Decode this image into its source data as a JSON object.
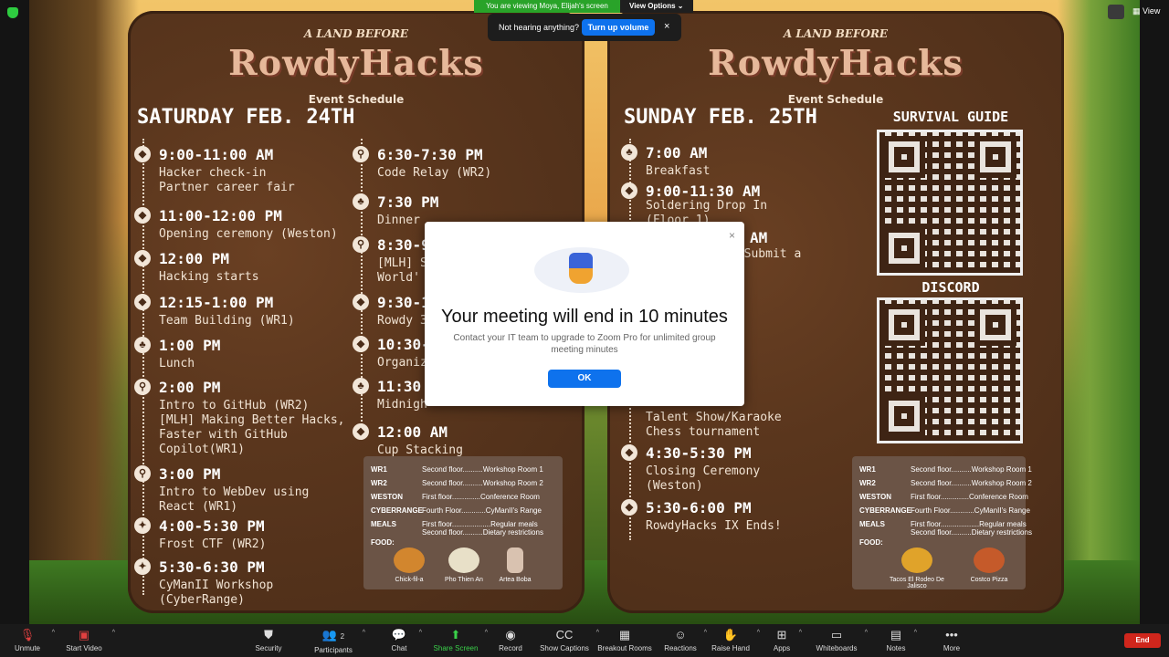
{
  "banner": {
    "viewing": "You are viewing Moya, Elijah's screen",
    "view_options": "View Options",
    "hearing_text": "Not hearing anything?",
    "turn_up": "Turn up volume",
    "close": "×",
    "view": "View"
  },
  "poster_left": {
    "logo_top": "A LAND BEFORE",
    "logo_main": "RowdyHacks",
    "logo_sub": "Event Schedule",
    "day": "SATURDAY FEB. 24TH",
    "col1": [
      {
        "time": "9:00-11:00 AM",
        "desc": "Hacker check-in\nPartner career fair"
      },
      {
        "time": "11:00-12:00 PM",
        "desc": "Opening ceremony (Weston)"
      },
      {
        "time": "12:00 PM",
        "desc": "Hacking starts"
      },
      {
        "time": "12:15-1:00 PM",
        "desc": "Team Building (WR1)"
      },
      {
        "time": "1:00 PM",
        "desc": "Lunch"
      },
      {
        "time": "2:00 PM",
        "desc": "Intro to GitHub (WR2)\n[MLH] Making Better Hacks,\nFaster with GitHub\nCopilot(WR1)"
      },
      {
        "time": "3:00 PM",
        "desc": "Intro to WebDev using\nReact (WR1)"
      },
      {
        "time": "4:00-5:30 PM",
        "desc": "Frost CTF (WR2)"
      },
      {
        "time": "5:30-6:30 PM",
        "desc": "CyManII Workshop\n(CyberRange)"
      }
    ],
    "col2": [
      {
        "time": "6:30-7:30 PM",
        "desc": "Code Relay (WR2)"
      },
      {
        "time": "7:30 PM",
        "desc": "Dinner"
      },
      {
        "time": "8:30-9",
        "desc": "[MLH] S\nWorld' ("
      },
      {
        "time": "9:30-1",
        "desc": "Rowdy 3"
      },
      {
        "time": "10:30-",
        "desc": "Organiz"
      },
      {
        "time": "11:30 P",
        "desc": "Midnigh"
      },
      {
        "time": "12:00 AM",
        "desc": "Cup Stacking"
      }
    ]
  },
  "poster_right": {
    "logo_top": "A LAND BEFORE",
    "logo_main": "RowdyHacks",
    "logo_sub": "Event Schedule",
    "day": "SUNDAY FEB. 25TH",
    "events": [
      {
        "time": "7:00 AM",
        "desc": "Breakfast"
      },
      {
        "time": "9:00-11:30 AM",
        "desc": "Soldering Drop In\n(Floor 1)"
      },
      {
        "time": "AM",
        "desc": "d Submit a"
      },
      {
        "time": "",
        "desc": "Talent Show/Karaoke\nChess tournament"
      },
      {
        "time": "4:30-5:30 PM",
        "desc": "Closing Ceremony\n(Weston)"
      },
      {
        "time": "5:30-6:00 PM",
        "desc": "RowdyHacks IX Ends!"
      }
    ],
    "survival": "SURVIVAL GUIDE",
    "discord": "DISCORD"
  },
  "legend": {
    "rows": [
      {
        "code": "WR1",
        "loc": "Second floor..........Workshop Room 1"
      },
      {
        "code": "WR2",
        "loc": "Second floor..........Workshop Room 2"
      },
      {
        "code": "WESTON",
        "loc": "First floor..............Conference Room"
      },
      {
        "code": "CYBERRANGE",
        "loc": "Fourth Floor............CyManII's Range"
      },
      {
        "code": "MEALS",
        "loc": "First floor...................Regular meals"
      },
      {
        "code": "",
        "loc": "Second floor..........Dietary restrictions"
      }
    ],
    "food": "FOOD:",
    "food_left": [
      "Chick-fil-a",
      "Pho Thien An",
      "Artea Boba"
    ],
    "food_right": [
      "Tacos El Rodeo De Jalisco",
      "Costco Pizza"
    ]
  },
  "modal": {
    "title": "Your meeting will end in 10 minutes",
    "message": "Contact your IT team to upgrade to Zoom Pro for unlimited group meeting minutes",
    "ok": "OK",
    "close": "×"
  },
  "toolbar": {
    "unmute": "Unmute",
    "start_video": "Start Video",
    "security": "Security",
    "participants": "Participants",
    "participants_count": "2",
    "chat": "Chat",
    "share_screen": "Share Screen",
    "record": "Record",
    "captions": "Show Captions",
    "breakout": "Breakout Rooms",
    "reactions": "Reactions",
    "raise_hand": "Raise Hand",
    "apps": "Apps",
    "whiteboards": "Whiteboards",
    "notes": "Notes",
    "more": "More",
    "end": "End"
  }
}
